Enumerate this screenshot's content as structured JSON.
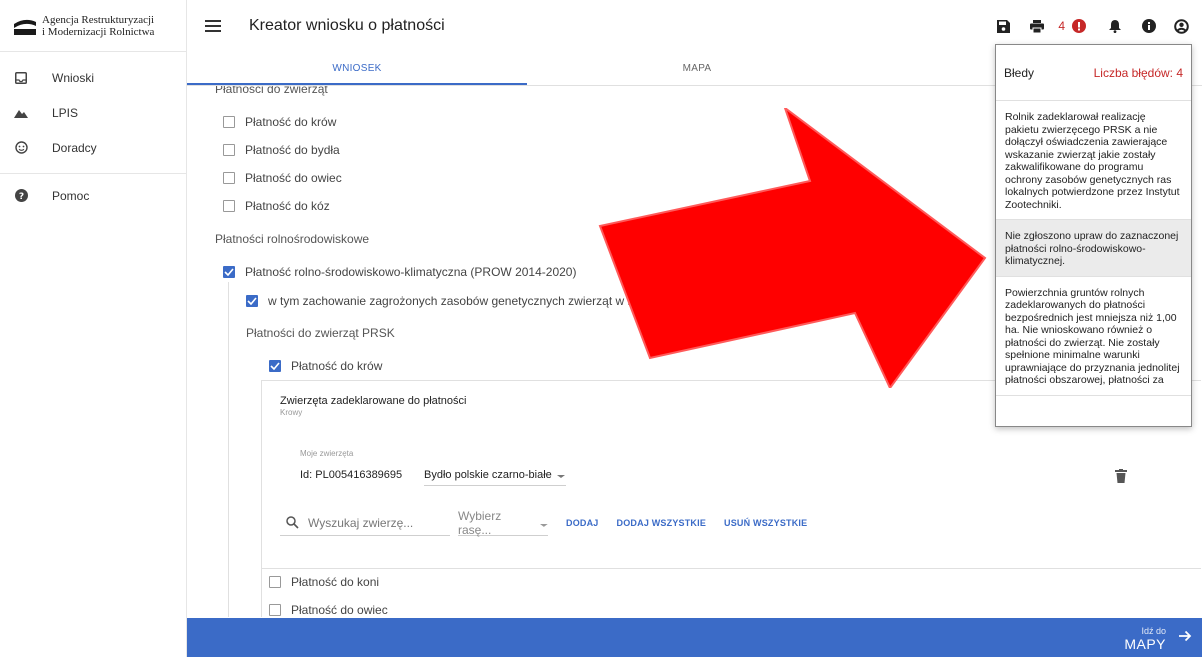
{
  "app": {
    "logo_line1": "Agencja Restrukturyzacji",
    "logo_line2": "i Modernizacji Rolnictwa"
  },
  "sidebar": {
    "items": [
      {
        "label": "Wnioski",
        "icon": "inbox-icon"
      },
      {
        "label": "LPIS",
        "icon": "mountains-icon"
      },
      {
        "label": "Doradcy",
        "icon": "face-icon"
      },
      {
        "label": "Pomoc",
        "icon": "help-icon"
      }
    ]
  },
  "header": {
    "title": "Kreator wniosku o płatności",
    "error_count": "4"
  },
  "tabs": [
    {
      "label": "WNIOSEK",
      "active": true
    },
    {
      "label": "MAPA",
      "active": false
    }
  ],
  "form": {
    "section_animals": "Płatności do zwierząt",
    "animal_payments": [
      {
        "label": "Płatność do krów",
        "checked": false
      },
      {
        "label": "Płatność do bydła",
        "checked": false
      },
      {
        "label": "Płatność do owiec",
        "checked": false
      },
      {
        "label": "Płatność do kóz",
        "checked": false
      }
    ],
    "section_agri_env": "Płatności rolnośrodowiskowe",
    "prow_label": "Płatność rolno-środowiskowo-klimatyczna (PROW 2014-2020)",
    "genetic_label": "w tym zachowanie zagrożonych zasobów genetycznych zwierząt w rolnictwie",
    "section_prsk": "Płatności do zwierząt PRSK",
    "prsk_cows": "Płatność do krów",
    "declared_title": "Zwierzęta zadeklarowane do płatności",
    "declared_sub": "Krowy",
    "my_animals_label": "Moje zwierzęta",
    "animal_id": "Id: PL005416389695",
    "animal_breed": "Bydło polskie czarno-białe",
    "search_placeholder": "Wyszukaj zwierzę...",
    "race_placeholder": "Wybierz rasę...",
    "btn_add": "DODAJ",
    "btn_add_all": "DODAJ WSZYSTKIE",
    "btn_remove_all": "USUŃ WSZYSTKIE",
    "prsk_horses": "Płatność do koni",
    "prsk_sheep": "Płatność do owiec"
  },
  "bottom_bar": {
    "goto_small": "Idź do",
    "goto_big": "MAPY"
  },
  "errors_panel": {
    "title": "Błedy",
    "count_label": "Liczba błędów: 4",
    "items": [
      "Rolnik zadeklarował realizację pakietu zwierzęcego PRSK a nie dołączył oświadczenia zawierające wskazanie zwierząt jakie zostały zakwalifikowane do programu ochrony zasobów genetycznych ras lokalnych potwierdzone przez Instytut Zootechniki.",
      "Nie zgłoszono upraw do zaznaczonej płatności rolno-środowiskowo-klimatycznej.",
      "Powierzchnia gruntów rolnych zadeklarowanych do płatności bezpośrednich jest mniejsza niż 1,00 ha. Nie wnioskowano również o płatności do zwierząt. Nie zostały spełnione minimalne warunki uprawniające do przyznania jednolitej płatności obszarowej, płatności za"
    ]
  },
  "colors": {
    "primary": "#3b6bc7",
    "error": "#c62828",
    "arrow": "#ff0000"
  }
}
